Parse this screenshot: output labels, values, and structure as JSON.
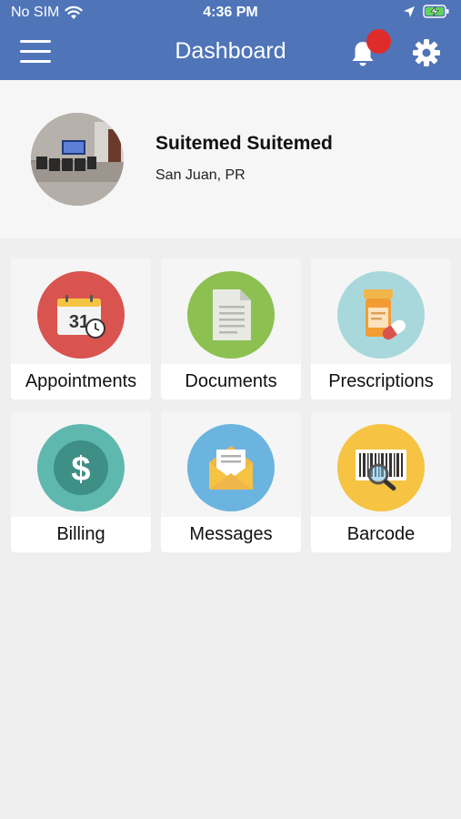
{
  "status_bar": {
    "carrier": "No SIM",
    "time": "4:36 PM",
    "icons": [
      "wifi-icon",
      "location-arrow-icon",
      "battery-charging-icon"
    ]
  },
  "nav": {
    "title": "Dashboard",
    "icons": [
      "hamburger-menu-icon",
      "bell-icon",
      "gear-icon"
    ],
    "notification_badge_color": "#e02b2b",
    "bar_color": "#4f74b8"
  },
  "profile": {
    "name": "Suitemed Suitemed",
    "location": "San Juan, PR"
  },
  "tiles": [
    {
      "label": "Appointments",
      "icon": "calendar-icon",
      "color": "#d9534f"
    },
    {
      "label": "Documents",
      "icon": "document-icon",
      "color": "#8cc152"
    },
    {
      "label": "Prescriptions",
      "icon": "pill-bottle-icon",
      "color": "#a8d8dc"
    },
    {
      "label": "Billing",
      "icon": "dollar-icon",
      "color": "#5fb8ad"
    },
    {
      "label": "Messages",
      "icon": "envelope-icon",
      "color": "#6cb4e0"
    },
    {
      "label": "Barcode",
      "icon": "barcode-icon",
      "color": "#f6c342"
    }
  ],
  "calendar_day": "31",
  "currency_symbol": "$"
}
